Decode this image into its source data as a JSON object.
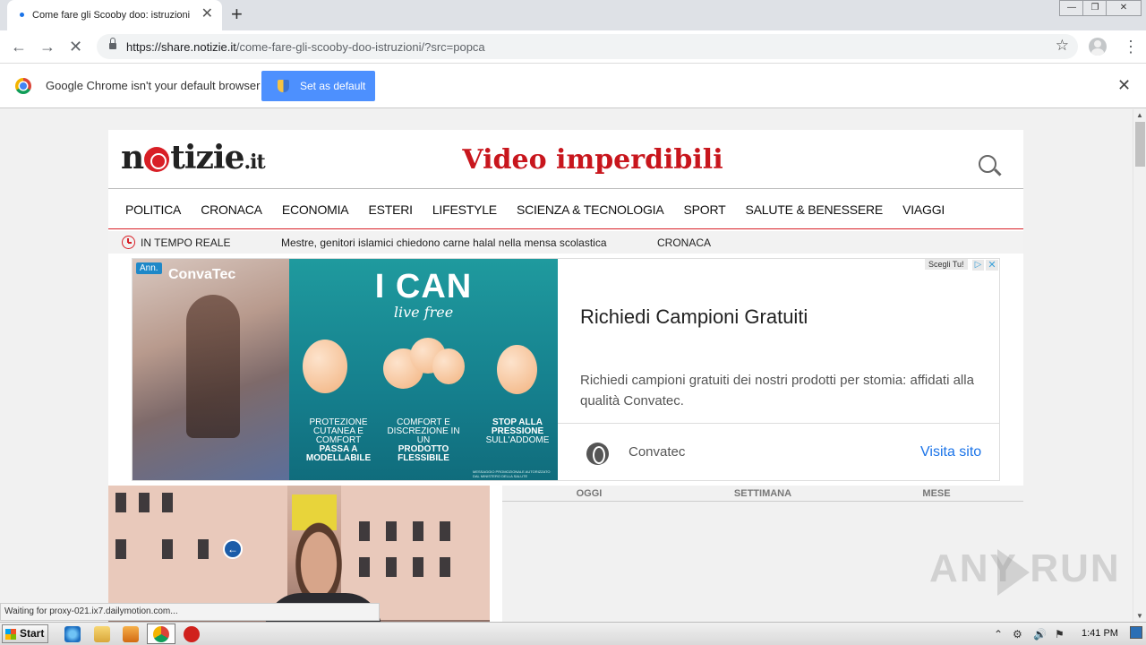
{
  "browser": {
    "tab_title": "Come fare gli Scooby doo: istruzioni",
    "tab_close": "✕",
    "new_tab": "+",
    "window_controls": [
      "—",
      "❐",
      "✕"
    ],
    "url_host": "https://share.notizie.it",
    "url_path": "/come-fare-gli-scooby-doo-istruzioni/?src=popca",
    "back": "←",
    "forward": "→",
    "reload": "✕",
    "star": "☆",
    "menu": "⋮"
  },
  "infobar": {
    "message": "Google Chrome isn't your default browser",
    "button_label": "Set as default",
    "close": "✕"
  },
  "site": {
    "logo_pre": "n",
    "logo_post": "tizie",
    "logo_tld": ".it",
    "headline": "Video imperdibili",
    "nav": [
      "POLITICA",
      "CRONACA",
      "ECONOMIA",
      "ESTERI",
      "LIFESTYLE",
      "SCIENZA & TECNOLOGIA",
      "SPORT",
      "SALUTE & BENESSERE",
      "VIAGGI"
    ],
    "ticker_label": "IN TEMPO REALE",
    "ticker_text": "Mestre, genitori islamici chiedono carne halal nella mensa scolastica",
    "ticker_category": "CRONACA",
    "tabs": [
      "OGGI",
      "SETTIMANA",
      "MESE"
    ]
  },
  "ad": {
    "badge": "Ann.",
    "brand_logo": "ConvaTec",
    "slogan": "I CAN",
    "slogan_script": "live free",
    "captions": [
      {
        "line1": "PROTEZIONE CUTANEA E COMFORT",
        "bold": "PASSA A MODELLABILE"
      },
      {
        "line1": "COMFORT E DISCREZIONE IN UN",
        "bold": "PRODOTTO FLESSIBILE"
      },
      {
        "line1": "",
        "bold": "STOP ALLA PRESSIONE",
        "line2": "SULL'ADDOME"
      }
    ],
    "fine_print": "MESSAGGIO PROMOZIONALE AUTORIZZATO DAL MINISTERO DELLA SALUTE",
    "choice_label": "Scegli Tu!",
    "choices_icon": "▷",
    "close_icon": "✕",
    "title": "Richiedi Campioni Gratuiti",
    "description": "Richiedi campioni gratuiti dei nostri prodotti per stomia: affidati alla qualità Convatec.",
    "advertiser": "Convatec",
    "cta": "Visita sito"
  },
  "status_text": "Waiting for proxy-021.ix7.dailymotion.com...",
  "watermark": "ANY  RUN",
  "taskbar": {
    "start_label": "Start",
    "time": "1:41 PM",
    "tray_icons": [
      "⌃",
      "⚙",
      "🔊",
      "⚑"
    ]
  },
  "colors": {
    "brand_red": "#d81f26",
    "link_blue": "#1a73e8",
    "button_blue": "#4d90fe",
    "ad_teal": "#157f8d"
  }
}
